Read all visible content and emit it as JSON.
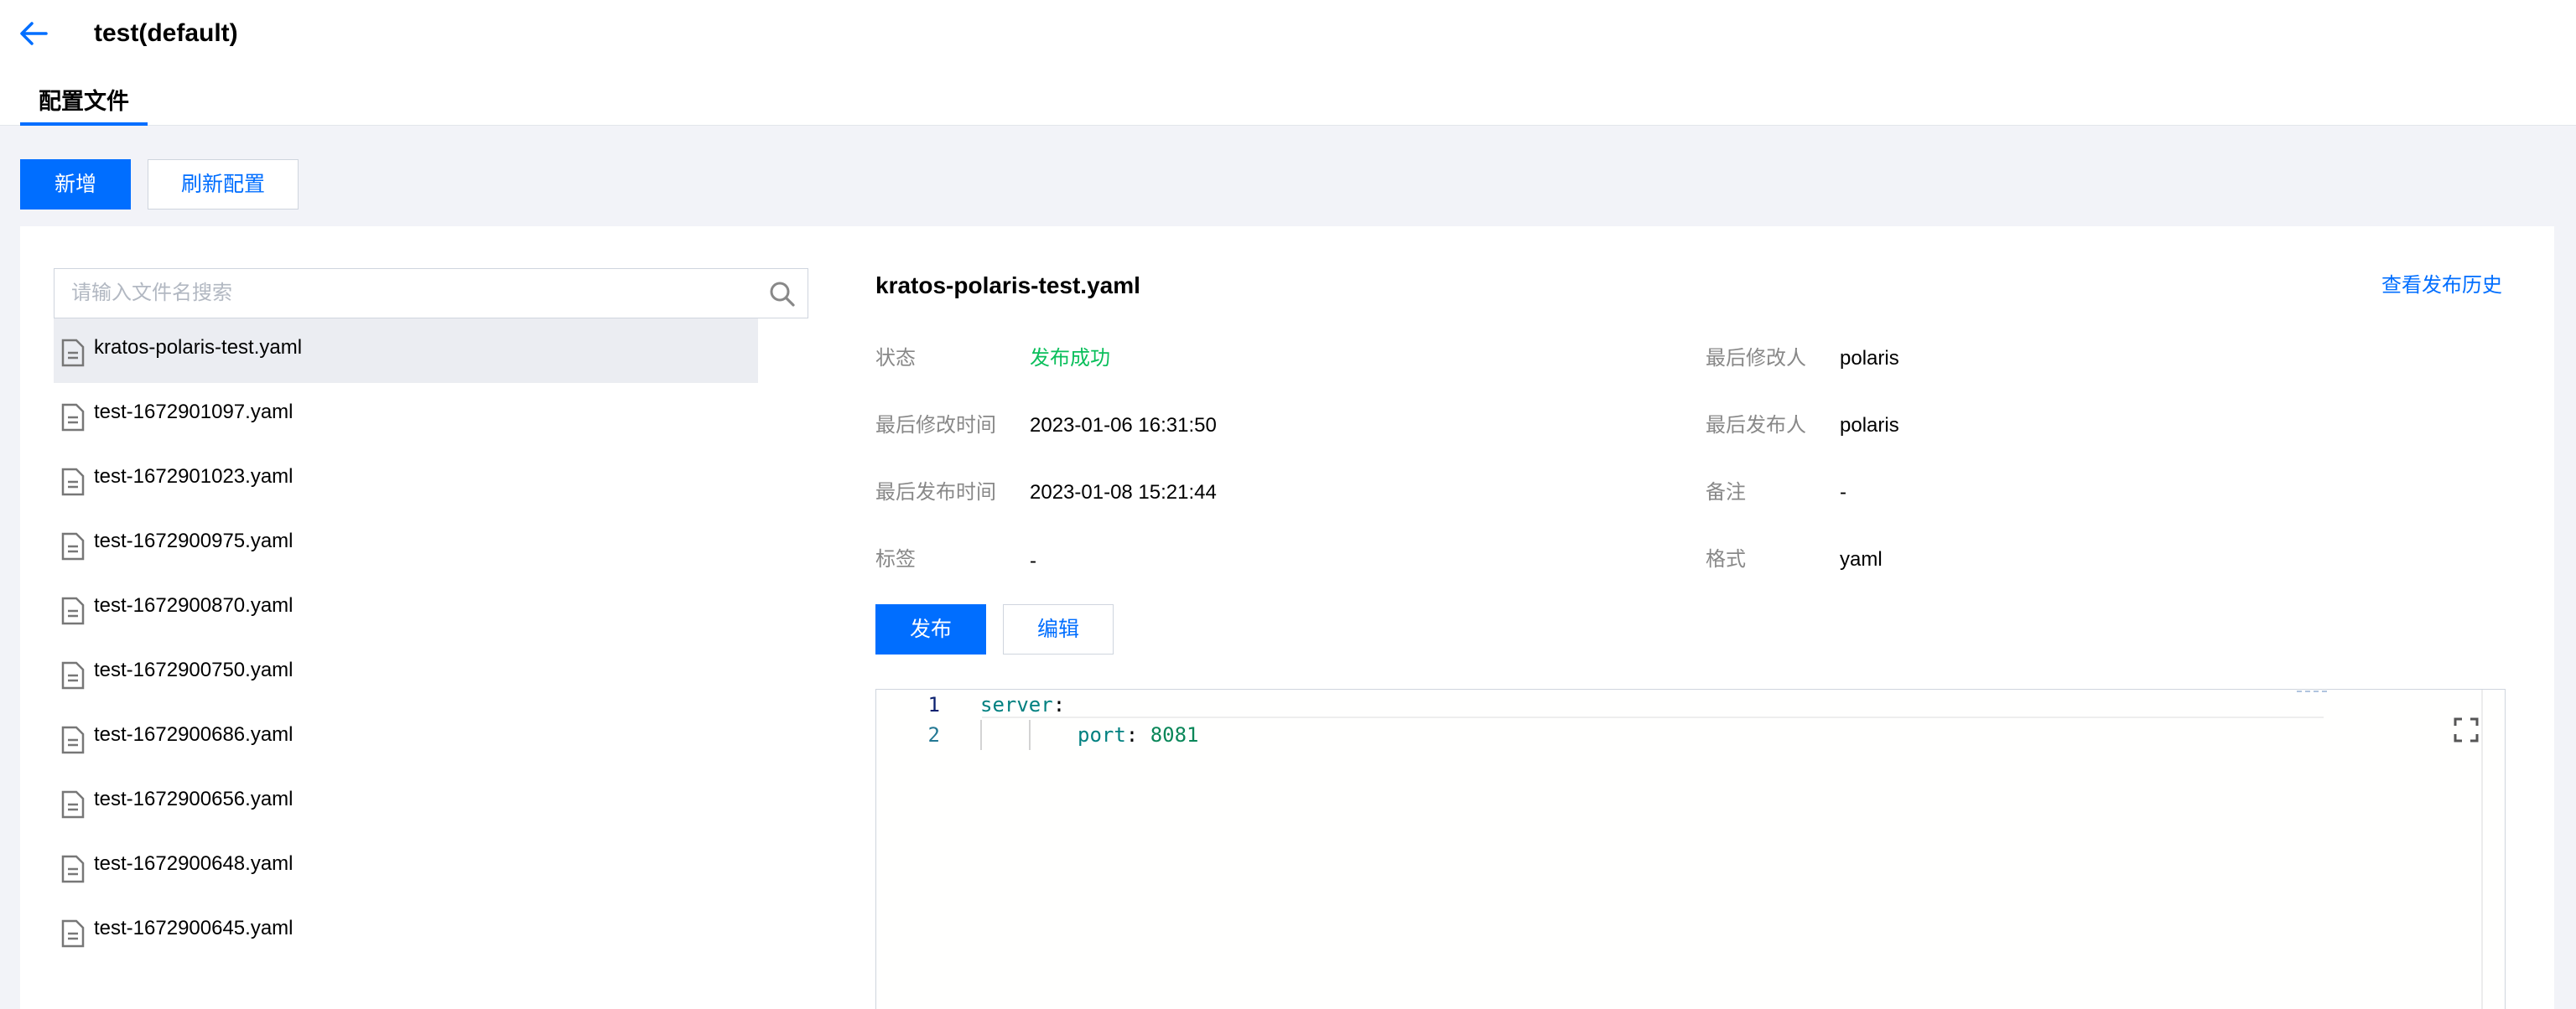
{
  "header": {
    "title": "test(default)",
    "back_icon": "arrow-left-icon"
  },
  "tabs": [
    {
      "label": "配置文件",
      "active": true
    }
  ],
  "toolbar": {
    "add_label": "新增",
    "refresh_label": "刷新配置"
  },
  "search": {
    "placeholder": "请输入文件名搜索",
    "value": ""
  },
  "files": [
    {
      "name": "kratos-polaris-test.yaml",
      "active": true
    },
    {
      "name": "test-1672901097.yaml"
    },
    {
      "name": "test-1672901023.yaml"
    },
    {
      "name": "test-1672900975.yaml"
    },
    {
      "name": "test-1672900870.yaml"
    },
    {
      "name": "test-1672900750.yaml"
    },
    {
      "name": "test-1672900686.yaml"
    },
    {
      "name": "test-1672900656.yaml"
    },
    {
      "name": "test-1672900648.yaml"
    },
    {
      "name": "test-1672900645.yaml"
    }
  ],
  "detail": {
    "title": "kratos-polaris-test.yaml",
    "history_link": "查看发布历史",
    "status_label": "状态",
    "status_value": "发布成功",
    "last_modifier_label": "最后修改人",
    "last_modifier_value": "polaris",
    "last_modified_time_label": "最后修改时间",
    "last_modified_time_value": "2023-01-06 16:31:50",
    "last_publisher_label": "最后发布人",
    "last_publisher_value": "polaris",
    "last_published_time_label": "最后发布时间",
    "last_published_time_value": "2023-01-08 15:21:44",
    "remark_label": "备注",
    "remark_value": "-",
    "tags_label": "标签",
    "tags_value": "-",
    "format_label": "格式",
    "format_value": "yaml",
    "publish_label": "发布",
    "edit_label": "编辑"
  },
  "editor": {
    "lines": [
      {
        "number": "1",
        "key": "server",
        "sep": ":",
        "value": ""
      },
      {
        "number": "2",
        "key": "port",
        "sep": ": ",
        "value": "8081"
      }
    ]
  },
  "colors": {
    "primary": "#006eff",
    "success": "#0abf5b",
    "page_bg": "#f2f3f8"
  }
}
